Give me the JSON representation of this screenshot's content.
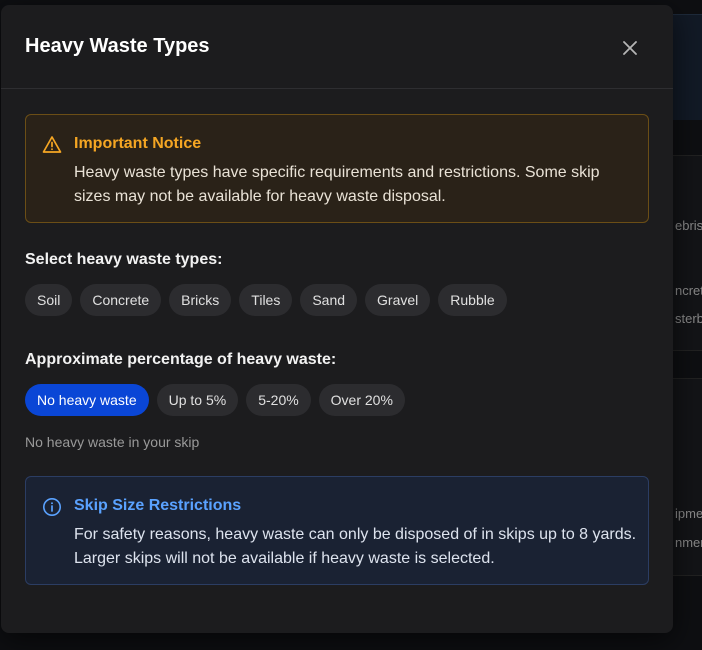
{
  "modal": {
    "title": "Heavy Waste Types",
    "close_icon": "close-icon"
  },
  "notice": {
    "icon": "warning-triangle-icon",
    "title": "Important Notice",
    "body": "Heavy waste types have specific requirements and restrictions. Some skip sizes may not be available for heavy waste disposal."
  },
  "waste_types": {
    "label": "Select heavy waste types:",
    "options": [
      "Soil",
      "Concrete",
      "Bricks",
      "Tiles",
      "Sand",
      "Gravel",
      "Rubble"
    ]
  },
  "percentage": {
    "label": "Approximate percentage of heavy waste:",
    "options": [
      "No heavy waste",
      "Up to 5%",
      "5-20%",
      "Over 20%"
    ],
    "selected": "No heavy waste",
    "hint": "No heavy waste in your skip"
  },
  "restrictions": {
    "icon": "info-circle-icon",
    "title": "Skip Size Restrictions",
    "body": "For safety reasons, heavy waste can only be disposed of in skips up to 8 yards. Larger skips will not be available if heavy waste is selected."
  },
  "background": {
    "fragments": [
      "ebris",
      "ncrete",
      "sterb",
      "ipme",
      "nmer"
    ]
  },
  "colors": {
    "accent_selected": "#0a46d6",
    "warning": "#f5a623",
    "info": "#5aa2ff",
    "modal_bg": "#1c1c1e"
  }
}
